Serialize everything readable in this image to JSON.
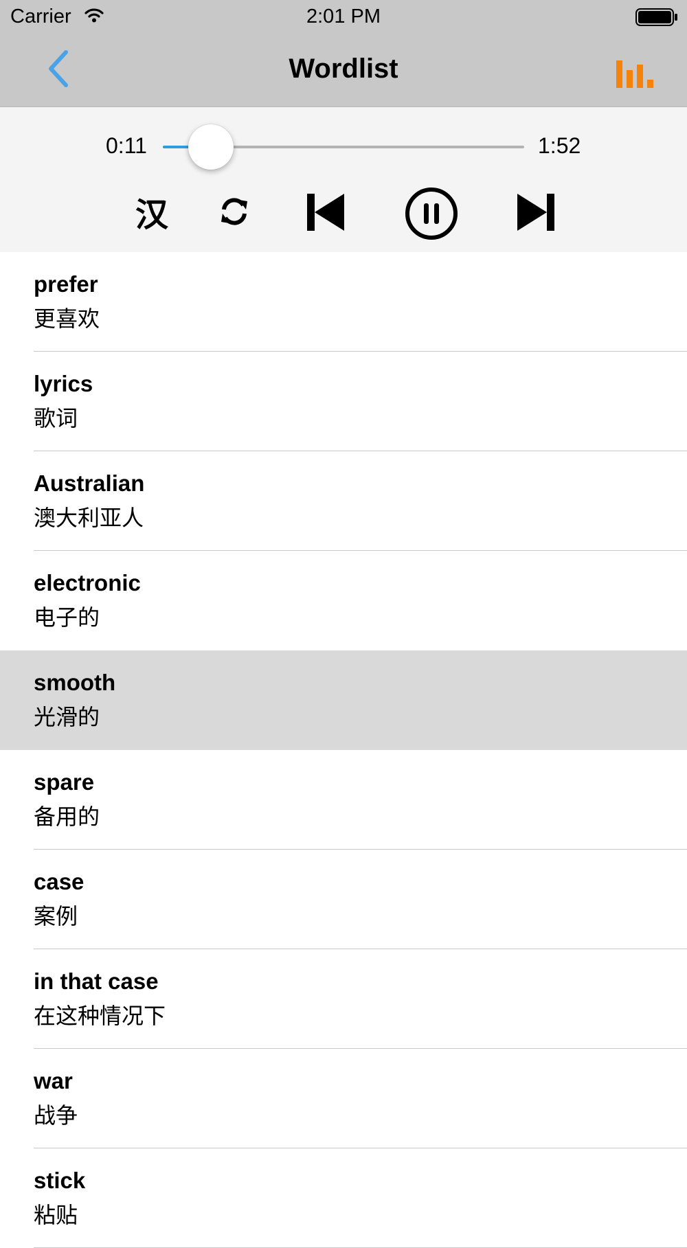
{
  "status_bar": {
    "carrier": "Carrier",
    "time": "2:01 PM"
  },
  "nav": {
    "title": "Wordlist",
    "back_icon": "chevron-left-icon",
    "stats_icon": "bar-chart-icon",
    "accent": "#4aa3e6",
    "stats_color": "#f5820b"
  },
  "player": {
    "elapsed": "0:11",
    "total": "1:52",
    "progress": 0.098,
    "language_label": "汉",
    "controls": [
      "repeat-icon",
      "skip-previous-icon",
      "pause-icon",
      "skip-next-icon"
    ],
    "progress_color": "#2a9fe0"
  },
  "words": [
    {
      "word": "prefer",
      "meaning": "更喜欢"
    },
    {
      "word": "lyrics",
      "meaning": "歌词"
    },
    {
      "word": "Australian",
      "meaning": "澳大利亚人"
    },
    {
      "word": "electronic",
      "meaning": "电子的"
    },
    {
      "word": "smooth",
      "meaning": "光滑的"
    },
    {
      "word": "spare",
      "meaning": "备用的"
    },
    {
      "word": "case",
      "meaning": "案例"
    },
    {
      "word": "in that case",
      "meaning": "在这种情况下"
    },
    {
      "word": "war",
      "meaning": "战争"
    },
    {
      "word": "stick",
      "meaning": "粘贴"
    }
  ],
  "selected_index": 4
}
